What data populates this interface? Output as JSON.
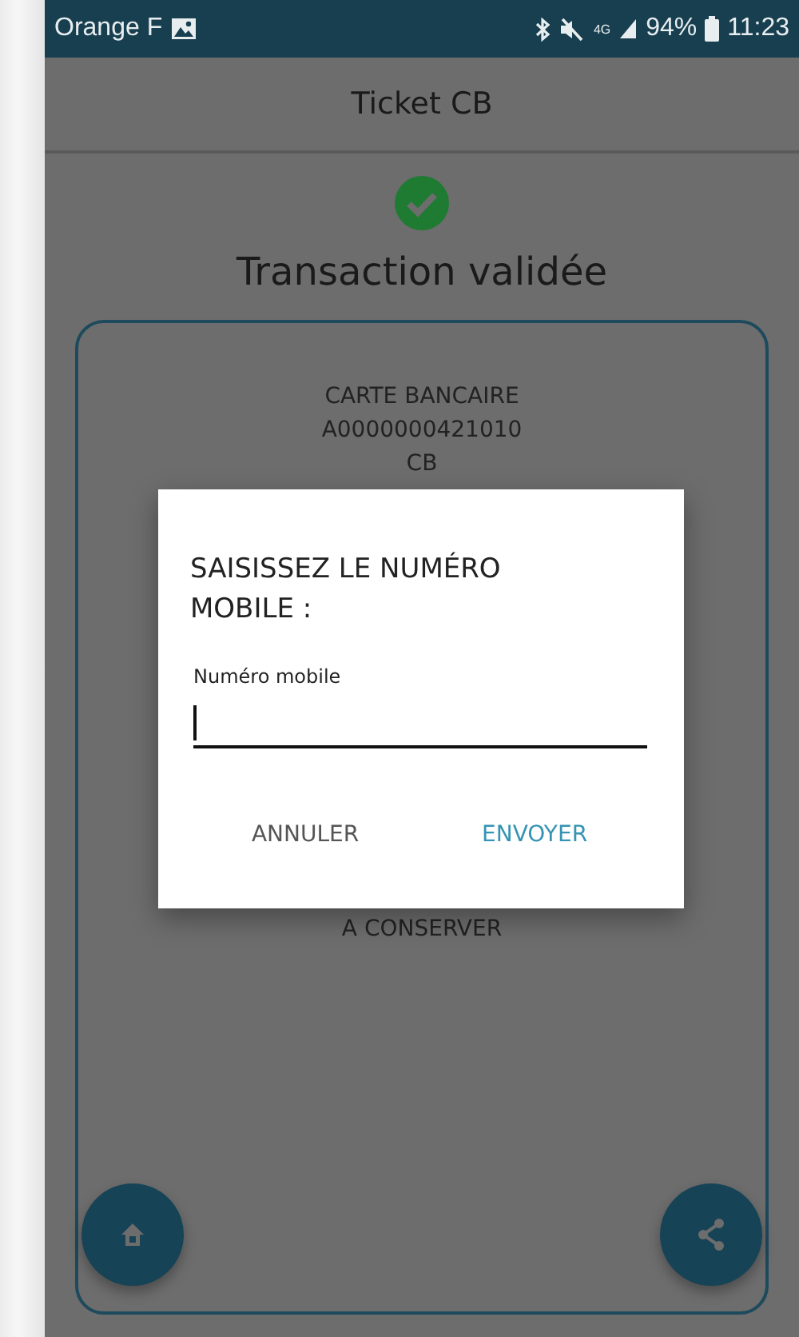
{
  "status_bar": {
    "carrier": "Orange F",
    "network": "4G",
    "battery": "94%",
    "time": "11:23"
  },
  "app_bar": {
    "title": "Ticket CB"
  },
  "result": {
    "validated": true,
    "message": "Transaction validée"
  },
  "receipt": {
    "lines": [
      "CARTE BANCAIRE",
      "A0000000421010",
      "CB"
    ],
    "footer": "A CONSERVER"
  },
  "dialog": {
    "title": "SAISISSEZ LE NUMÉRO MOBILE :",
    "field": {
      "label": "Numéro mobile",
      "focused": true
    },
    "buttons": [
      {
        "label": "ANNULER",
        "kind": "neutral"
      },
      {
        "label": "ENVOYER",
        "kind": "primary"
      }
    ]
  },
  "fabs": [
    {
      "kind": "home"
    },
    {
      "kind": "share"
    }
  ]
}
